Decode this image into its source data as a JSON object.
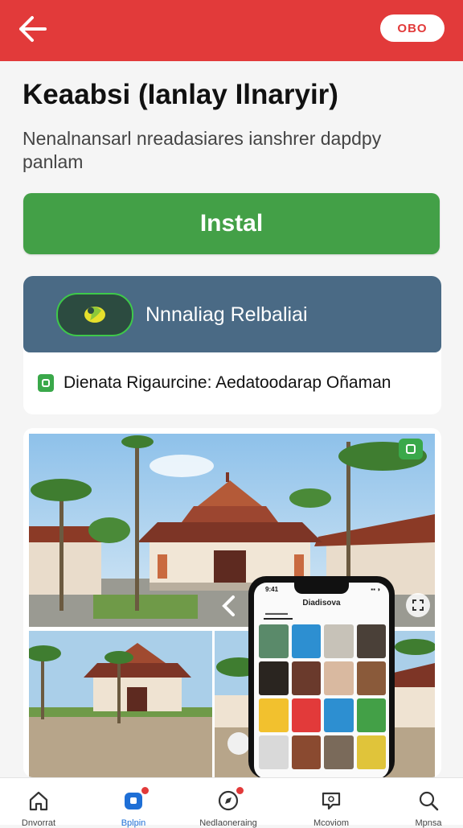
{
  "header": {
    "background": "#e23a3a",
    "back_icon": "arrow-left-icon",
    "pill_label": "OBO"
  },
  "app": {
    "title": "Keaabsi (Ianlay Ilnaryir)",
    "subtitle": "Nenalnansarl nreadasiares ianshrer dapdpy panlam",
    "install_label": "Instal",
    "install_color": "#43a047"
  },
  "promo": {
    "label": "Nnnaliag Relbaliai",
    "banner_color": "#4a6a85",
    "icon": "leaf-badge-icon"
  },
  "info": {
    "text": "Dienata Rigaurcine: Aedatoodarap Oñaman",
    "icon": "check-badge-icon"
  },
  "gallery": {
    "badge_icon": "check-badge-icon",
    "phone": {
      "title": "Diadisova",
      "time": "9:41"
    }
  },
  "bottom_nav": {
    "items": [
      {
        "label": "Dnvorrat",
        "icon": "home-icon"
      },
      {
        "label": "Bplpin",
        "icon": "apps-icon"
      },
      {
        "label": "Nedlaoneraing",
        "icon": "compass-icon"
      },
      {
        "label": "Mcoviom",
        "icon": "message-icon"
      },
      {
        "label": "Mpnsa",
        "icon": "search-icon"
      }
    ]
  }
}
